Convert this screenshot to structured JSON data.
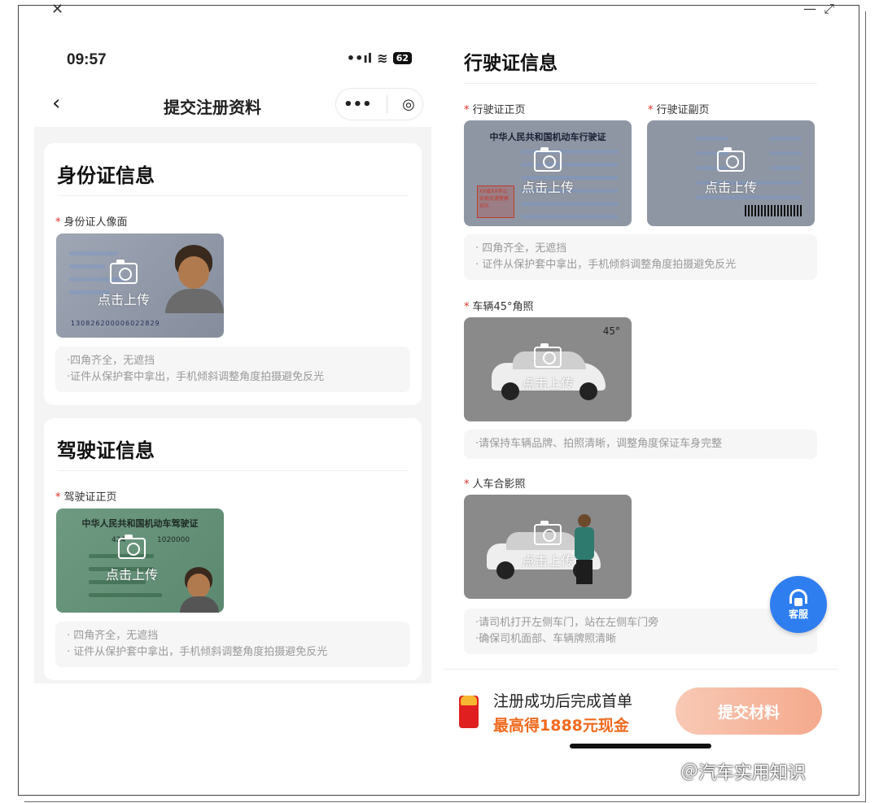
{
  "window": {
    "close": "✕",
    "controls": "— ⤢"
  },
  "status": {
    "time": "09:57",
    "signal": "••ıl",
    "wifi": "≋",
    "battery": "62"
  },
  "nav": {
    "back": "‹",
    "title": "提交注册资料",
    "more": "•••",
    "target": "◎"
  },
  "upload_text": "点击上传",
  "id_card": {
    "title": "身份证信息",
    "field": "身份证人像面",
    "tips": [
      "·四角齐全，无遮挡",
      "·证件从保护套中拿出，手机倾斜调整角度拍摄避免反光"
    ],
    "number": "130826200006022829"
  },
  "driver_license": {
    "title": "驾驶证信息",
    "field": "驾驶证正页",
    "card_heading": "中华人民共和国机动车驾驶证",
    "id_fragment": "424",
    "id_tail": "1020000",
    "tips": [
      "· 四角齐全，无遮挡",
      "· 证件从保护套中拿出，手机倾斜调整角度拍摄避免反光"
    ]
  },
  "vehicle_license": {
    "title": "行驶证信息",
    "front_field": "行驶证正页",
    "back_field": "行驶证副页",
    "front_heading": "中华人民共和国机动车行驶证",
    "stamp": "XX省XX市公安局交通警察支队",
    "tips": [
      "· 四角齐全，无遮挡",
      "· 证件从保护套中拿出，手机倾斜调整角度拍摄避免反光"
    ]
  },
  "car45": {
    "field": "车辆45°角照",
    "badge": "45°",
    "tip": "·请保持车辆品牌、拍照清晰，调整角度保证车身完整"
  },
  "person_car": {
    "field": "人车合影照",
    "tips": [
      "·请司机打开左侧车门，站在左侧车门旁",
      "·确保司机面部、车辆牌照清晰"
    ]
  },
  "service": {
    "label": "客服"
  },
  "bottom": {
    "promo_line1": "注册成功后完成首单",
    "promo_line2": "最高得1888元现金",
    "submit": "提交材料"
  },
  "watermark": "＠汽车实用知识",
  "colors": {
    "required_star": "#e02e24",
    "promo_orange": "#f06a1e",
    "service_blue": "#2f7ef0",
    "submit_gradient": "#f4a98c"
  }
}
